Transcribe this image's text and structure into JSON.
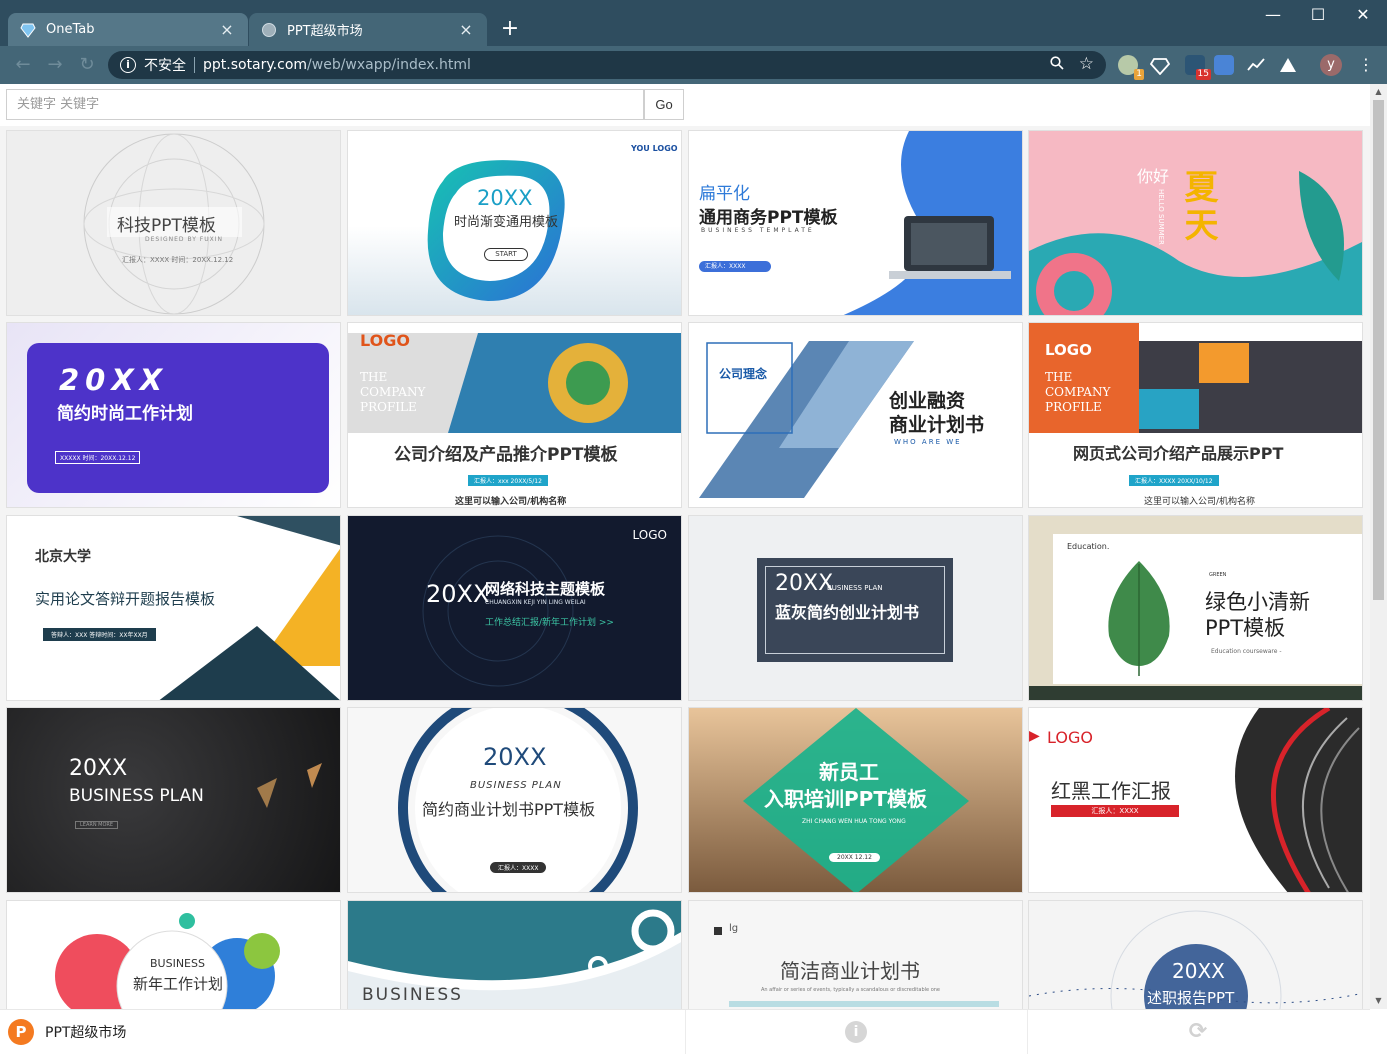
{
  "browser": {
    "tabs": [
      {
        "title": "OneTab",
        "close": "×"
      },
      {
        "title": "PPT超级市场",
        "close": "×"
      }
    ],
    "new_tab": "+",
    "window_controls": {
      "minimize": "—",
      "maximize": "☐",
      "close": "✕"
    },
    "address": {
      "security_label": "不安全",
      "url_host": "ppt.sotary.com",
      "url_path": "/web/wxapp/index.html"
    },
    "extensions": [
      {
        "name": "extension-1-icon",
        "badge": "1",
        "color": "#9fb8a0"
      },
      {
        "name": "extension-diamond-icon",
        "badge": "",
        "color": "#3b6b8a"
      },
      {
        "name": "extension-calendar-icon",
        "badge": "15",
        "color": "#2c5575"
      },
      {
        "name": "extension-translate-icon",
        "badge": "",
        "color": "#4a84d6"
      },
      {
        "name": "extension-chart-icon",
        "badge": "",
        "color": "#3e5c6c"
      },
      {
        "name": "extension-triangle-icon",
        "badge": "",
        "color": "#3e5c6c"
      }
    ],
    "avatar_letter": "y"
  },
  "search": {
    "placeholder": "关键字 关键字",
    "button": "Go"
  },
  "cards": [
    {
      "title": "科技PPT模板",
      "sub": "DESIGNED BY FUXIN",
      "meta": "汇报人：XXXX  时间：20XX.12.12"
    },
    {
      "title": "时尚渐变通用模板",
      "year": "20XX",
      "logo": "YOU LOGO",
      "button": "START"
    },
    {
      "title": "通用商务PPT模板",
      "sub": "扁平化",
      "sub2": "BUSINESS TEMPLATE",
      "meta": "汇报人：XXXX"
    },
    {
      "title": "夏天",
      "sub": "你好",
      "sub2": "HELLO SUMMER"
    },
    {
      "year": "20XX",
      "title": "简约时尚工作计划",
      "meta": "XXXXX  时间：20XX.12.12"
    },
    {
      "logo": "LOGO",
      "sub": "THE COMPANY PROFILE",
      "title": "公司介绍及产品推介PPT模板",
      "meta": "汇报人：xxx   20XX/5/12",
      "footer": "这里可以输入公司/机构名称"
    },
    {
      "sub": "公司理念",
      "title": "创业融资",
      "title2": "商业计划书",
      "sub2": "WHO ARE WE"
    },
    {
      "logo": "LOGO",
      "sub": "THE COMPANY PROFILE",
      "title": "网页式公司介绍产品展示PPT",
      "meta": "汇报人：XXXX   20XX/10/12",
      "footer": "这里可以输入公司/机构名称"
    },
    {
      "logo": "北京大学",
      "title": "实用论文答辩开题报告模板",
      "meta": "答辩人：XXX   答辩时间：XX年XX月"
    },
    {
      "year": "20XX",
      "title": "网络科技主题模板",
      "sub": "CHUANGXIN KEJI YIN LING WEILAI",
      "sub2": "工作总结汇报/新年工作计划 >>",
      "logo": "LOGO"
    },
    {
      "year": "20XX",
      "sub": "BUSINESS PLAN",
      "title": "蓝灰简约创业计划书"
    },
    {
      "sub": "Education.",
      "title": "绿色小清新",
      "title2": "PPT模板",
      "meta": "Education courseware -",
      "tag": "GREEN"
    },
    {
      "year": "20XX",
      "title": "BUSINESS PLAN",
      "sub": "LEARN MORE"
    },
    {
      "year": "20XX",
      "sub": "BUSINESS PLAN",
      "title": "简约商业计划书PPT模板",
      "meta": "汇报人：XXXX"
    },
    {
      "title": "新员工",
      "title2": "入职培训PPT模板",
      "sub": "ZHI CHANG WEN HUA TONG YONG",
      "meta": "20XX 12.12"
    },
    {
      "logo": "LOGO",
      "title": "红黑工作汇报",
      "meta": "汇报人：XXXX"
    },
    {
      "sub": "BUSINESS",
      "title": "新年工作计划"
    },
    {
      "title": "BUSINESS"
    },
    {
      "logo": "lg",
      "title": "简洁商业计划书",
      "sub": "An affair or series of events, typically a scandalous or discreditable one"
    },
    {
      "year": "20XX",
      "title": "述职报告PPT"
    }
  ],
  "bottom_bar": {
    "app_logo": "P",
    "app_name": "PPT超级市场"
  },
  "colors": {
    "titlebar": "#2f4d5f",
    "toolbar": "#446677",
    "omnibox": "#1f3746"
  }
}
